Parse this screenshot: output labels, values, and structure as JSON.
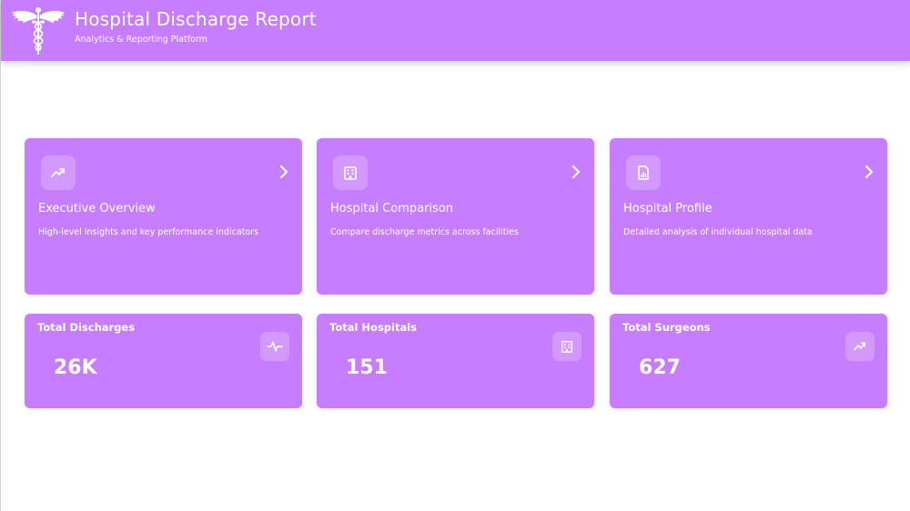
{
  "header": {
    "title": "Hospital Discharge Report",
    "subtitle": "Analytics & Reporting Platform",
    "logo_icon": "caduceus-icon"
  },
  "nav_cards": [
    {
      "icon": "trending-up-icon",
      "title": "Executive Overview",
      "description": "High-level insights and key performance indicators"
    },
    {
      "icon": "hospital-building-icon",
      "title": "Hospital Comparison",
      "description": "Compare discharge metrics across facilities"
    },
    {
      "icon": "document-chart-icon",
      "title": "Hospital Profile",
      "description": "Detailed analysis of individual hospital data"
    }
  ],
  "stats": [
    {
      "label": "Total Discharges",
      "value": "26K",
      "icon": "activity-pulse-icon"
    },
    {
      "label": "Total Hospitals",
      "value": "151",
      "icon": "hospital-building-icon"
    },
    {
      "label": "Total Surgeons",
      "value": "627",
      "icon": "trending-up-icon"
    }
  ],
  "colors": {
    "accent": "#c77dff",
    "text": "#ffffff",
    "background": "#ffffff"
  }
}
